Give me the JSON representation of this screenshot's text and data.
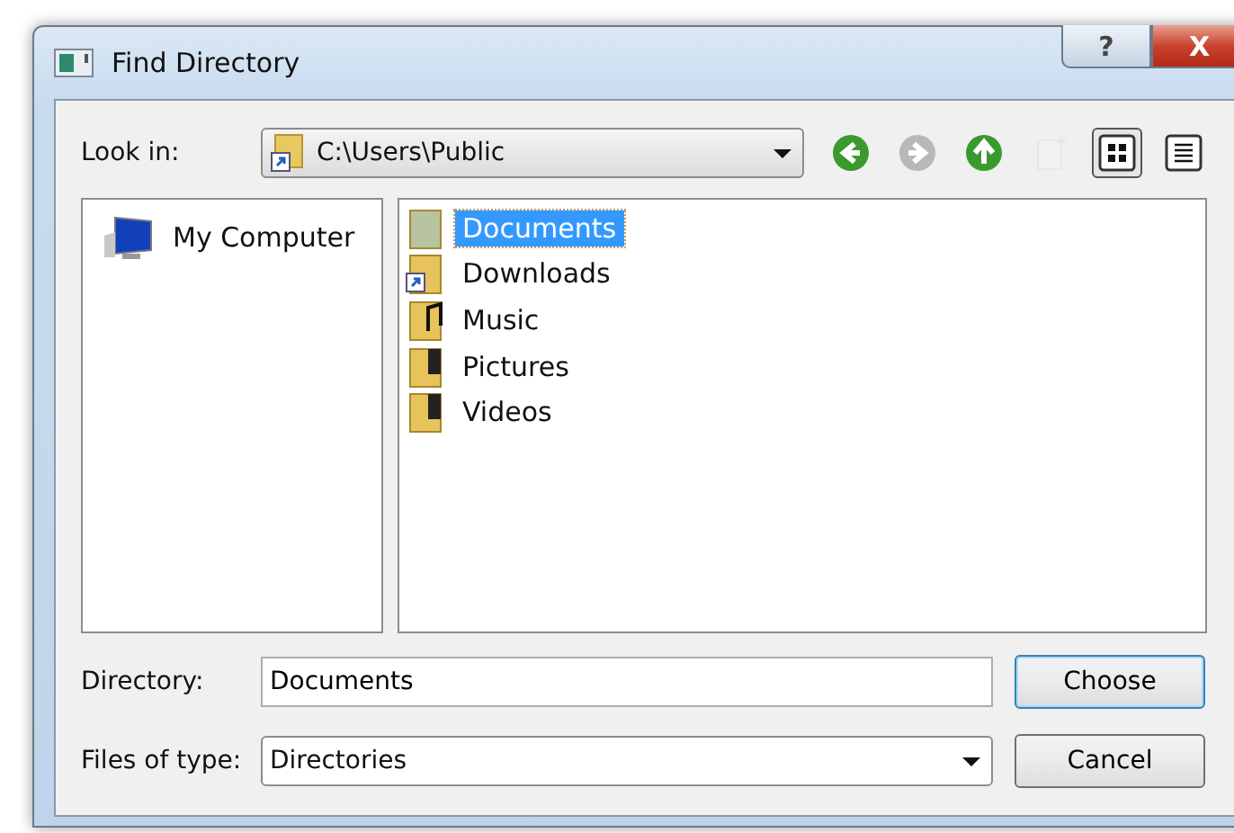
{
  "window": {
    "title": "Find Directory",
    "buttons": [
      {
        "kind": "help",
        "label": "?"
      },
      {
        "kind": "close",
        "label": "X"
      }
    ]
  },
  "look_in": {
    "label": "Look in:",
    "value": "C:\\Users\\Public"
  },
  "toolbar": [
    {
      "kind": "back",
      "disabled": false,
      "selected": false
    },
    {
      "kind": "forward",
      "disabled": true,
      "selected": false
    },
    {
      "kind": "up",
      "disabled": false,
      "selected": false
    },
    {
      "kind": "new-folder",
      "disabled": true,
      "selected": false
    },
    {
      "kind": "detail-view",
      "disabled": false,
      "selected": true
    },
    {
      "kind": "list-view",
      "disabled": false,
      "selected": false
    }
  ],
  "sidebar": {
    "items": [
      {
        "label": "My Computer"
      }
    ]
  },
  "files": [
    {
      "name": "Documents",
      "kind": "documents",
      "selected": true
    },
    {
      "name": "Downloads",
      "kind": "shortcut",
      "selected": false
    },
    {
      "name": "Music",
      "kind": "music",
      "selected": false
    },
    {
      "name": "Pictures",
      "kind": "media",
      "selected": false
    },
    {
      "name": "Videos",
      "kind": "media",
      "selected": false
    }
  ],
  "directory": {
    "label": "Directory:",
    "value": "Documents"
  },
  "files_of_type": {
    "label": "Files of type:",
    "value": "Directories"
  },
  "buttons": [
    {
      "label": "Choose",
      "kind": "default"
    },
    {
      "label": "Cancel",
      "kind": "normal"
    }
  ]
}
